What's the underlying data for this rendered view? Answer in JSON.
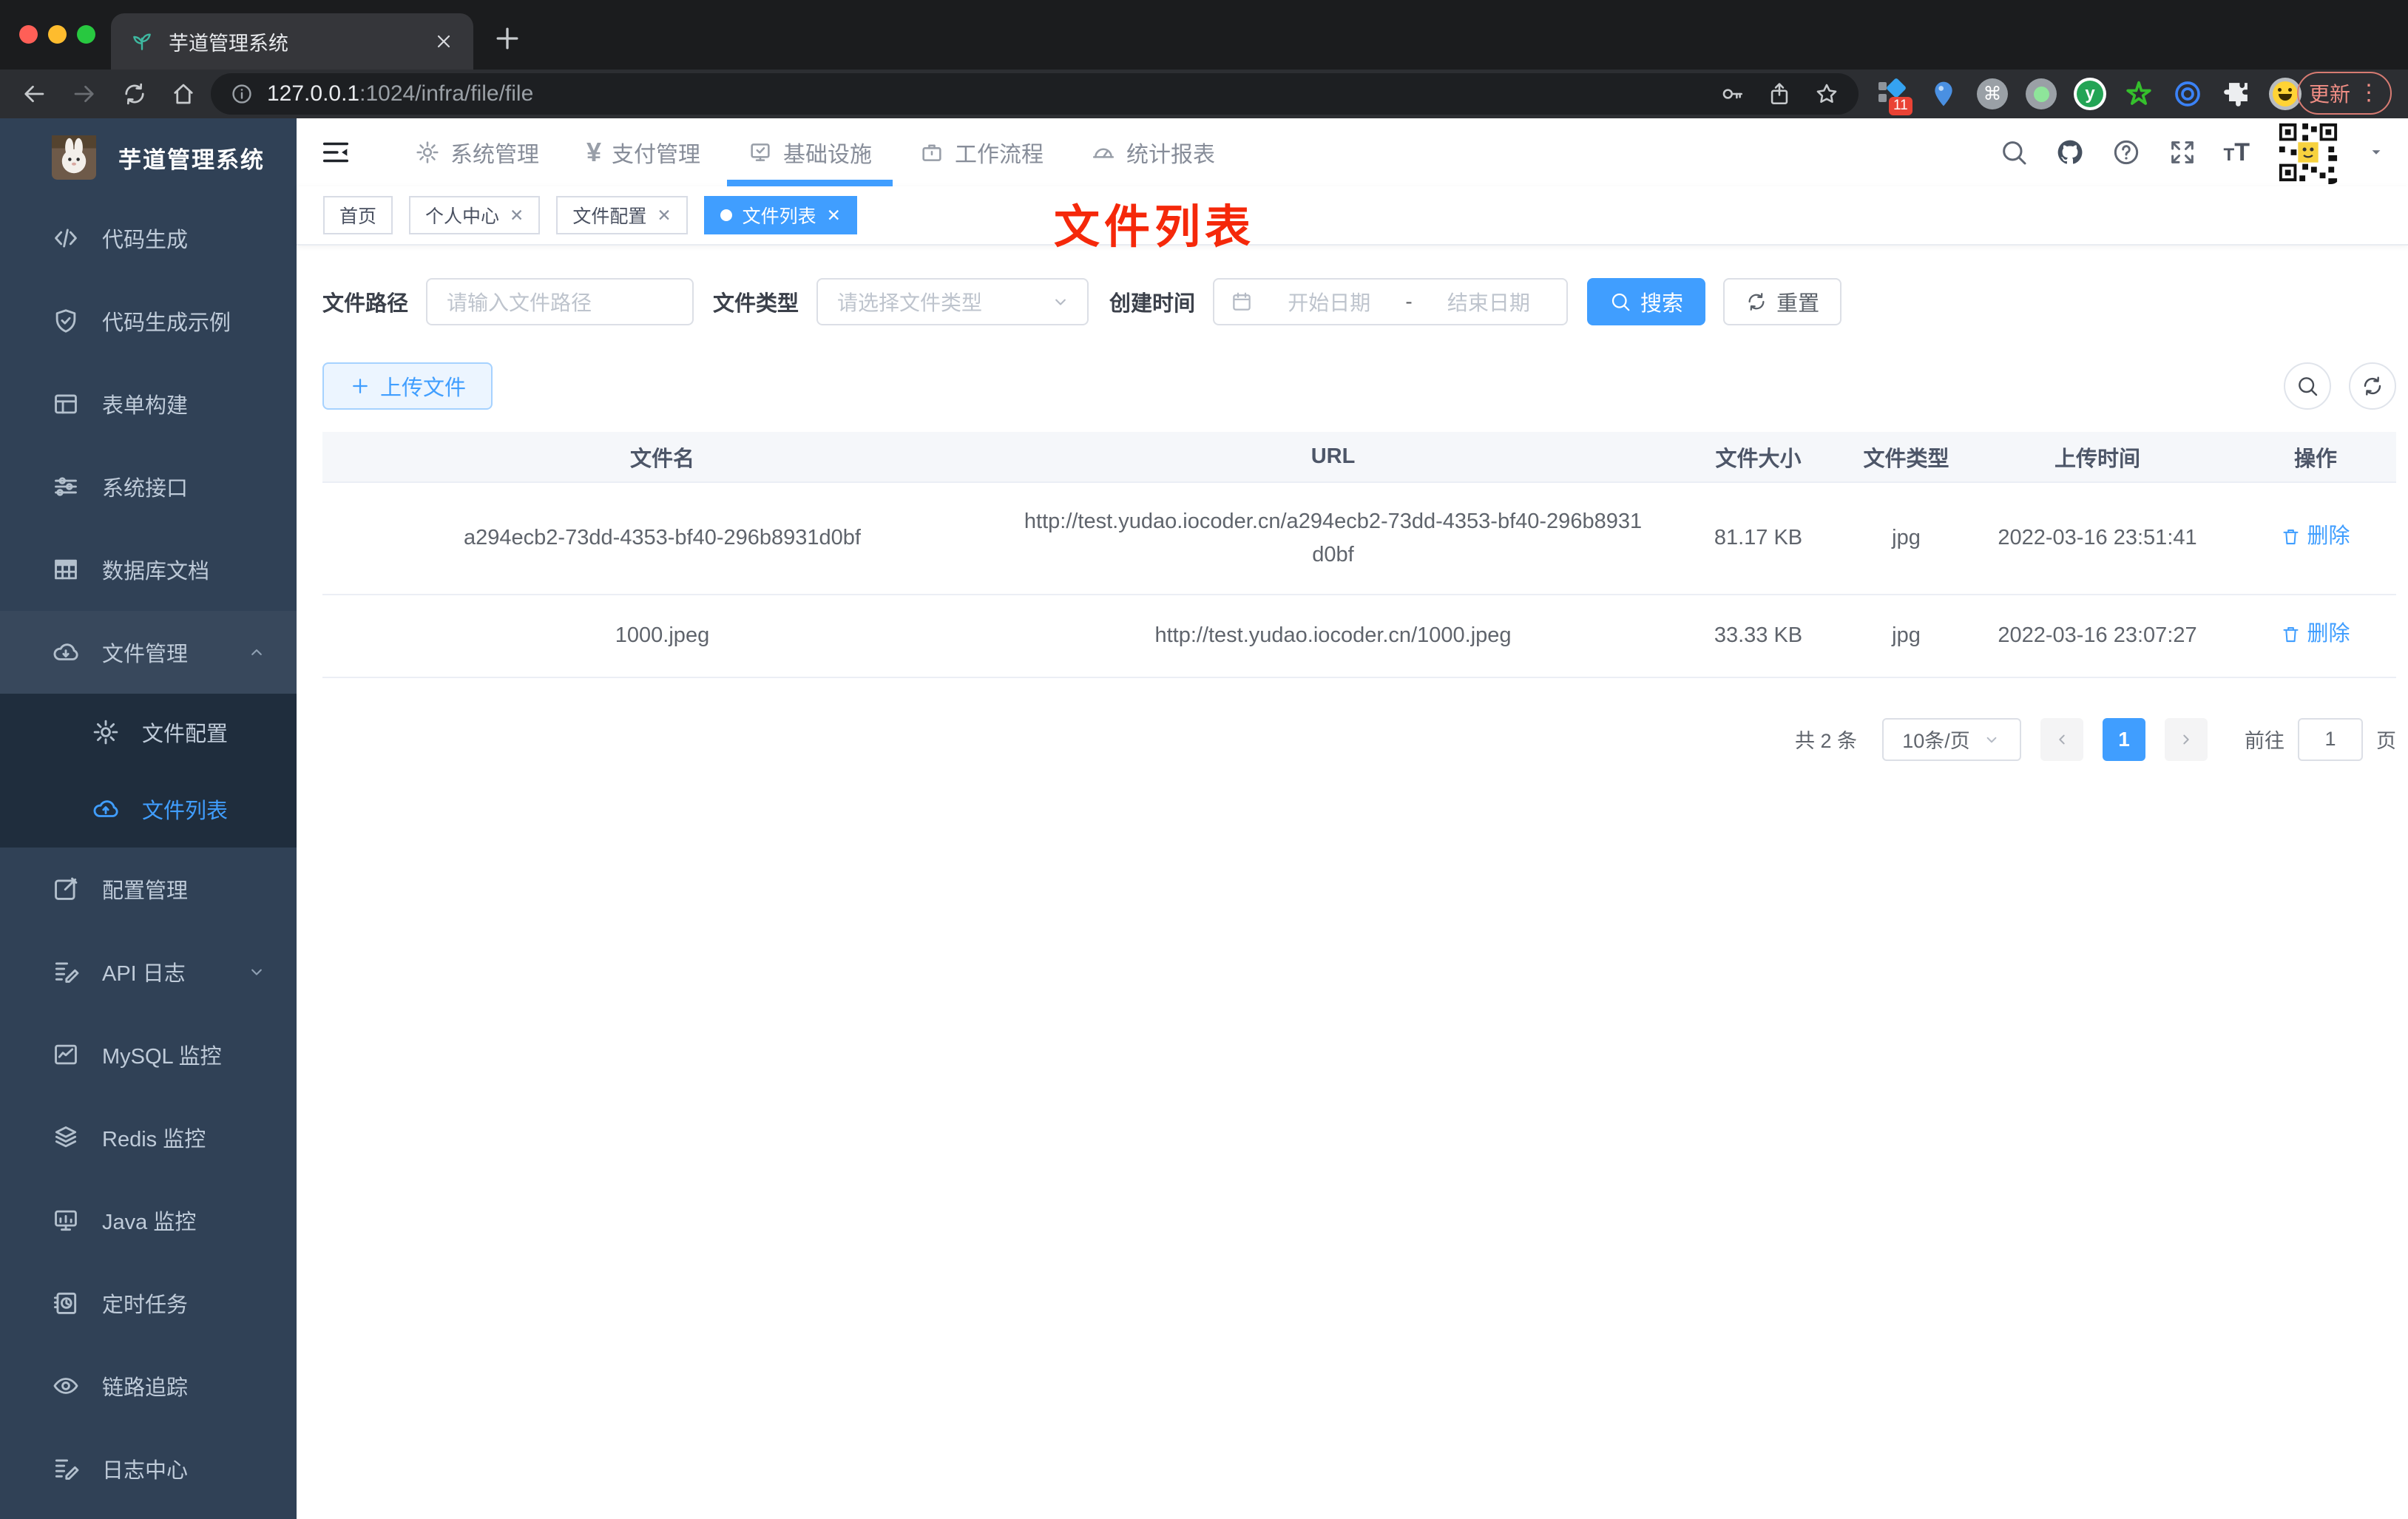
{
  "browser": {
    "tab_title": "芋道管理系统",
    "url_host": "127.0.0.1",
    "url_rest": ":1024/infra/file/file",
    "ext_badge": "11",
    "update_label": "更新",
    "menu_dots": "⋮",
    "cmd_glyph": "⌘",
    "y_glyph": "y"
  },
  "sidebar": {
    "title": "芋道管理系统",
    "items": [
      "代码生成",
      "代码生成示例",
      "表单构建",
      "系统接口",
      "数据库文档",
      "文件管理",
      "文件配置",
      "文件列表",
      "配置管理",
      "API 日志",
      "MySQL 监控",
      "Redis 监控",
      "Java 监控",
      "定时任务",
      "链路追踪",
      "日志中心"
    ]
  },
  "nav": {
    "items": [
      "系统管理",
      "支付管理",
      "基础设施",
      "工作流程",
      "统计报表"
    ],
    "yen_glyph": "¥"
  },
  "tags": {
    "items": [
      "首页",
      "个人中心",
      "文件配置",
      "文件列表"
    ],
    "close_glyph": "✕"
  },
  "annotation": "文件列表",
  "filters": {
    "path_label": "文件路径",
    "path_placeholder": "请输入文件路径",
    "type_label": "文件类型",
    "type_placeholder": "请选择文件类型",
    "time_label": "创建时间",
    "start_placeholder": "开始日期",
    "range_separator": "-",
    "end_placeholder": "结束日期",
    "search_label": "搜索",
    "reset_label": "重置"
  },
  "toolbar": {
    "upload_label": "上传文件"
  },
  "table": {
    "headers": [
      "文件名",
      "URL",
      "文件大小",
      "文件类型",
      "上传时间",
      "操作"
    ],
    "rows": [
      {
        "name": "a294ecb2-73dd-4353-bf40-296b8931d0bf",
        "url": "http://test.yudao.iocoder.cn/a294ecb2-73dd-4353-bf40-296b8931d0bf",
        "size": "81.17 KB",
        "type": "jpg",
        "time": "2022-03-16 23:51:41",
        "action": "删除"
      },
      {
        "name": "1000.jpeg",
        "url": "http://test.yudao.iocoder.cn/1000.jpeg",
        "size": "33.33 KB",
        "type": "jpg",
        "time": "2022-03-16 23:07:27",
        "action": "删除"
      }
    ]
  },
  "pagination": {
    "total": "共 2 条",
    "page_size": "10条/页",
    "current_page": "1",
    "goto_label": "前往",
    "goto_value": "1",
    "page_unit": "页"
  },
  "colors": {
    "accent": "#409eff",
    "annotation_red": "#f5280a",
    "sidebar_bg": "#304156",
    "submenu_bg": "#1f2d3d"
  }
}
